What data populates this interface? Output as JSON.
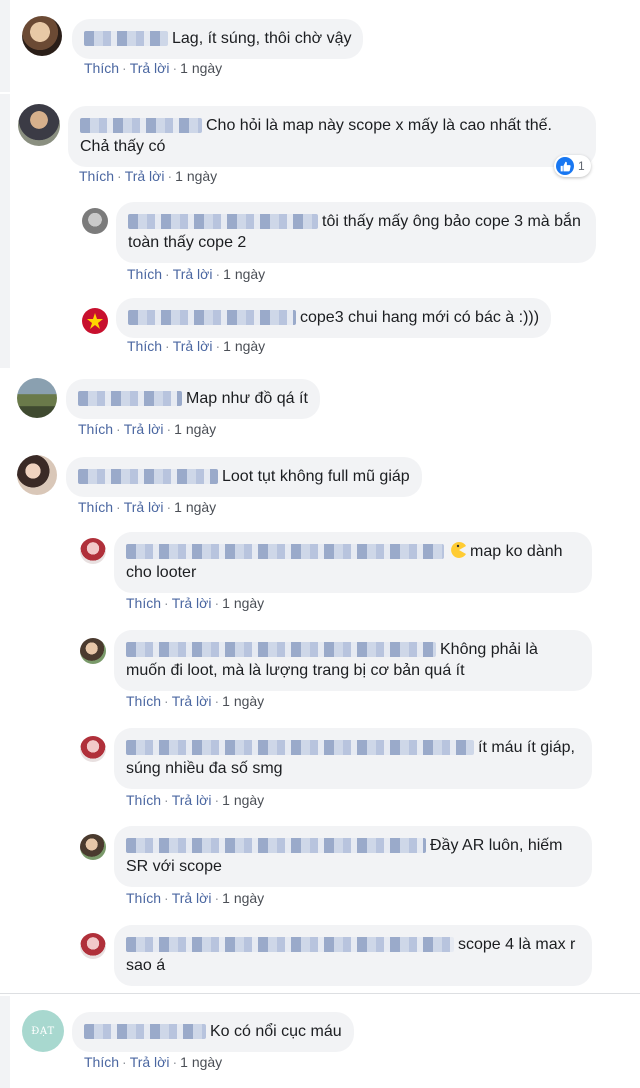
{
  "colors": {
    "link": "#4b67a1",
    "bubble": "#f2f3f5",
    "like": "#1877f2"
  },
  "actions": {
    "like": "Thích",
    "reply": "Trả lời",
    "separator": "·"
  },
  "comments": [
    {
      "text": "Lag, ít súng, thôi chờ vậy",
      "time": "1 ngày"
    },
    {
      "text": "Cho hỏi là map này scope x mấy là cao nhất thế. Chả thấy có",
      "time": "1 ngày",
      "reaction_count": "1",
      "replies": [
        {
          "text": "tôi thấy mấy ông bảo cope 3 mà bắn toàn thấy cope 2",
          "time": "1 ngày"
        },
        {
          "text": "cope3 chui hang mới có bác à :)))",
          "time": "1 ngày"
        }
      ]
    },
    {
      "text": "Map như đồ qá ít",
      "time": "1 ngày"
    },
    {
      "text": "Loot tụt không full mũ giáp",
      "time": "1 ngày",
      "replies": [
        {
          "text": "map ko dành cho looter",
          "time": "1 ngày",
          "emoji": "pacman-emoji-icon"
        },
        {
          "text": "Không phải là muốn đi loot, mà là lượng trang bị cơ bản quá ít",
          "time": "1 ngày"
        },
        {
          "text": "ít máu ít giáp, súng nhiều đa số smg",
          "time": "1 ngày"
        },
        {
          "text": "Đầy AR luôn, hiếm SR với scope",
          "time": "1 ngày"
        },
        {
          "text": "scope 4 là max r sao á",
          "time": "1 ngày"
        }
      ]
    },
    {
      "text": "Ko có nổi cục máu",
      "time": "1 ngày",
      "avatar_label": "ĐẠT"
    }
  ]
}
